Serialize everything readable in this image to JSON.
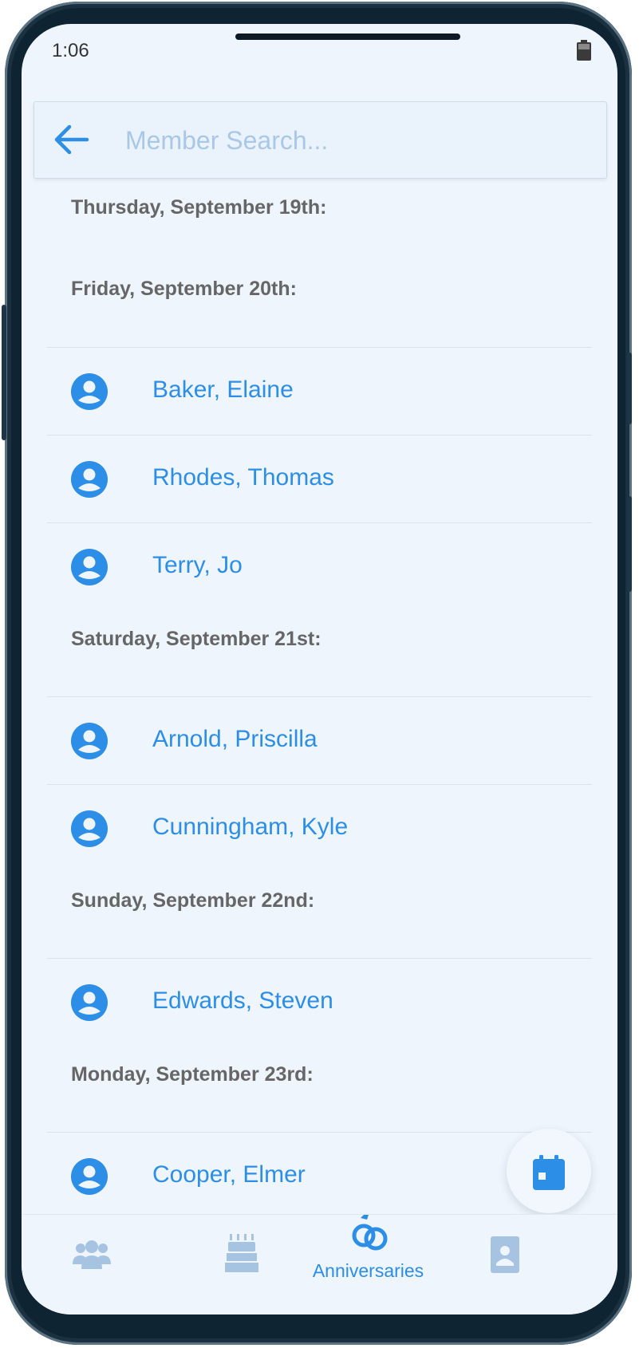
{
  "status_bar": {
    "time": "1:06"
  },
  "search": {
    "placeholder": "Member Search..."
  },
  "sections": [
    {
      "date": "Thursday, September 19th:",
      "members": []
    },
    {
      "date": "Friday, September 20th:",
      "members": [
        "Baker, Elaine",
        "Rhodes, Thomas",
        "Terry, Jo"
      ]
    },
    {
      "date": "Saturday, September 21st:",
      "members": [
        "Arnold, Priscilla",
        "Cunningham, Kyle"
      ]
    },
    {
      "date": "Sunday, September 22nd:",
      "members": [
        "Edwards, Steven"
      ]
    },
    {
      "date": "Monday, September 23rd:",
      "members": [
        "Cooper, Elmer"
      ]
    }
  ],
  "bottom_nav": {
    "items": [
      {
        "icon": "members-icon",
        "label": ""
      },
      {
        "icon": "birthday-cake-icon",
        "label": ""
      },
      {
        "icon": "rings-icon",
        "label": "Anniversaries",
        "active": true
      },
      {
        "icon": "contact-card-icon",
        "label": ""
      }
    ]
  },
  "colors": {
    "accent": "#2c8ee6",
    "inactive_icon": "#a7c3e2",
    "background": "#eef5fd"
  }
}
